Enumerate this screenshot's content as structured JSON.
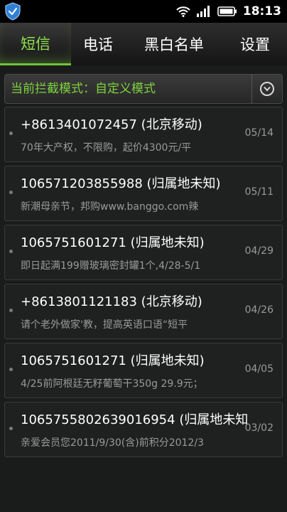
{
  "status_bar": {
    "time": "18:13",
    "icons": [
      "shield-app-icon",
      "wifi-icon",
      "signal-icon",
      "battery-icon"
    ]
  },
  "tabs": [
    {
      "label": "短信",
      "active": true
    },
    {
      "label": "电话",
      "active": false
    },
    {
      "label": "黑白名单",
      "active": false
    },
    {
      "label": "设置",
      "active": false
    }
  ],
  "mode": {
    "label": "当前拦截模式：自定义模式",
    "dropdown_icon": "chevron-down-circle-icon"
  },
  "colors": {
    "accent_green": "#7fd23e",
    "background": "#1a1b1b"
  },
  "messages": [
    {
      "sender": "+8613401072457 (北京移动)",
      "preview": "70年大产权，不限购，起价4300元/平",
      "date": "05/14"
    },
    {
      "sender": "10657120385598​8 (归属地未知)",
      "preview": "新潮母亲节，邦购www.banggo.com辣",
      "date": "05/11"
    },
    {
      "sender": "1065751601271 (归属地未知)",
      "preview": "即日起满199赠玻璃密封罐1个,4/28-5/1",
      "date": "04/29"
    },
    {
      "sender": "+8613801121183 (北京移动)",
      "preview": "请个老外做家'教，提高英语口语“短平",
      "date": "04/26"
    },
    {
      "sender": "1065751601271 (归属地未知)",
      "preview": "4/25前阿根廷无籽葡萄干350g 29.9元；",
      "date": "04/05"
    },
    {
      "sender": "1065755802639016954 (归属地未知",
      "preview": "亲爱会员您2011/9/30(含)前积分2012/3",
      "date": "03/02"
    }
  ]
}
